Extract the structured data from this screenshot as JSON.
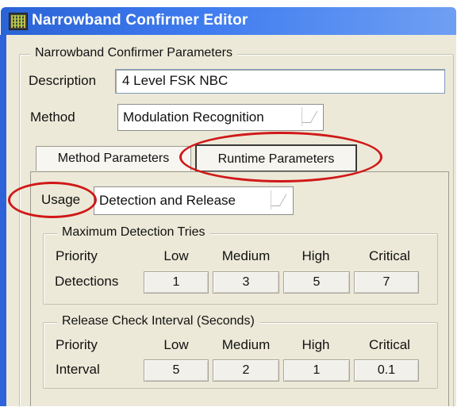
{
  "window": {
    "title": "Narrowband Confirmer Editor"
  },
  "params_group": {
    "legend": "Narrowband Confirmer Parameters"
  },
  "description": {
    "label": "Description",
    "value": "4 Level FSK NBC"
  },
  "method": {
    "label": "Method",
    "value": "Modulation Recognition"
  },
  "tabs": [
    {
      "label": "Method Parameters"
    },
    {
      "label": "Runtime Parameters"
    }
  ],
  "usage": {
    "label": "Usage",
    "value": "Detection and Release"
  },
  "detection_group": {
    "legend": "Maximum Detection Tries",
    "header_label": "Priority",
    "columns": [
      "Low",
      "Medium",
      "High",
      "Critical"
    ],
    "row_label": "Detections",
    "values": [
      "1",
      "3",
      "5",
      "7"
    ]
  },
  "release_group": {
    "legend": "Release Check Interval (Seconds)",
    "header_label": "Priority",
    "columns": [
      "Low",
      "Medium",
      "High",
      "Critical"
    ],
    "row_label": "Interval",
    "values": [
      "5",
      "2",
      "1",
      "0.1"
    ]
  },
  "annotation_color": "#d01818",
  "accent_color": "#2a63d6"
}
